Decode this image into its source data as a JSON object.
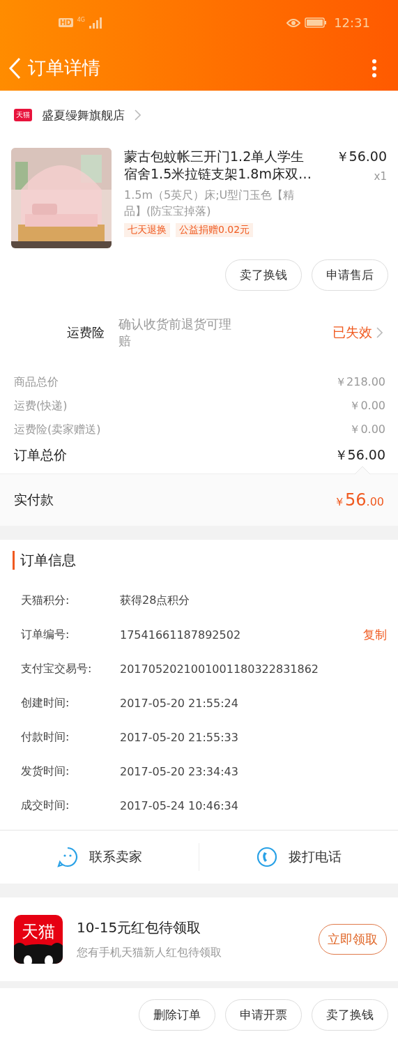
{
  "status_bar": {
    "hd_label": "HD",
    "network_label": "4G",
    "time": "12:31"
  },
  "header": {
    "title": "订单详情"
  },
  "shop": {
    "badge": "天猫",
    "name": "盛夏缦舞旗舰店"
  },
  "product": {
    "title": "蒙古包蚊帐三开门1.2单人学生宿舍1.5米拉链支架1.8m床双…",
    "price": "￥56.00",
    "quantity": "x1",
    "sku": "1.5m（5英尺）床;U型门玉色【精品】(防宝宝掉落)",
    "tags": [
      "七天退换",
      "公益捐赠0.02元"
    ],
    "actions": [
      "卖了换钱",
      "申请售后"
    ]
  },
  "freight_insurance": {
    "label": "运费险",
    "description": "确认收货前退货可理赔",
    "status": "已失效"
  },
  "price_rows": [
    {
      "label": "商品总价",
      "value": "￥218.00",
      "kind": "minor"
    },
    {
      "label": "运费(快递)",
      "value": "￥0.00",
      "kind": "minor"
    },
    {
      "label": "运费险(卖家赠送)",
      "value": "￥0.00",
      "kind": "minor"
    },
    {
      "label": "订单总价",
      "value": "￥56.00",
      "kind": "total"
    }
  ],
  "paid": {
    "label": "实付款",
    "currency": "￥",
    "integer": "56",
    "decimals": ".00"
  },
  "order_info": {
    "title": "订单信息",
    "rows": [
      {
        "label": "天猫积分:",
        "value": "获得28点积分"
      },
      {
        "label": "订单编号:",
        "value": "17541661187892502",
        "action": "复制"
      },
      {
        "label": "支付宝交易号:",
        "value": "2017052021001001180322831862"
      },
      {
        "label": "创建时间:",
        "value": "2017-05-20 21:55:24"
      },
      {
        "label": "付款时间:",
        "value": "2017-05-20 21:55:33"
      },
      {
        "label": "发货时间:",
        "value": "2017-05-20 23:34:43"
      },
      {
        "label": "成交时间:",
        "value": "2017-05-24 10:46:34"
      }
    ]
  },
  "contact": [
    {
      "kind": "chat",
      "label": "联系卖家"
    },
    {
      "kind": "phone",
      "label": "拨打电话"
    }
  ],
  "promo": {
    "logo": "天猫",
    "title": "10-15元红包待领取",
    "subtitle": "您有手机天猫新人红包待领取",
    "button": "立即领取"
  },
  "bottom_actions": [
    "删除订单",
    "申请开票",
    "卖了换钱"
  ]
}
